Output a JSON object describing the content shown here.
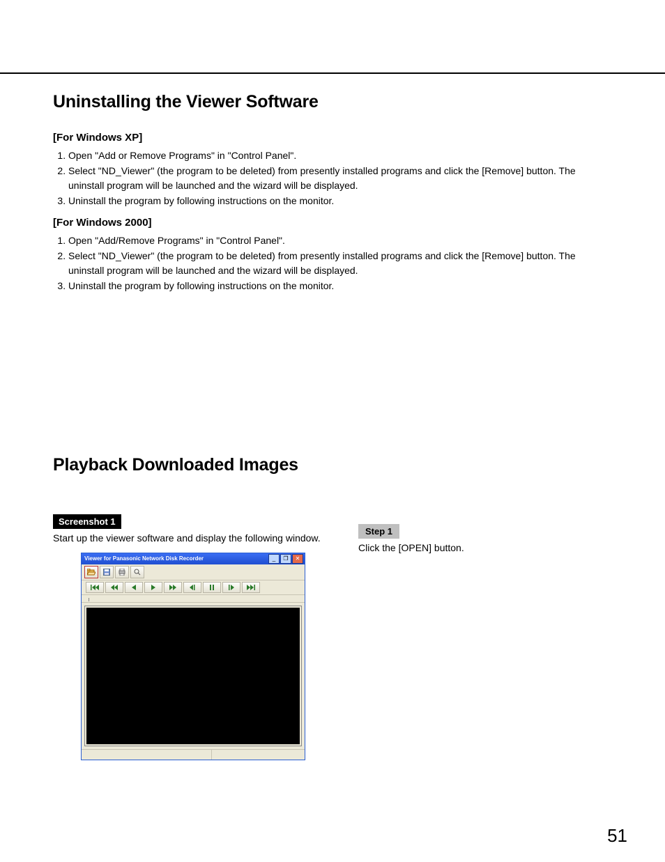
{
  "section1": {
    "title": "Uninstalling the Viewer Software",
    "xp": {
      "heading": "[For Windows XP]",
      "steps": [
        "Open \"Add or Remove Programs\" in \"Control Panel\".",
        "Select \"ND_Viewer\" (the program to be deleted) from presently installed programs and click the [Remove] button. The uninstall program will be launched and the wizard will be displayed.",
        "Uninstall the program by following instructions on the monitor."
      ]
    },
    "w2k": {
      "heading": "[For Windows 2000]",
      "steps": [
        "Open \"Add/Remove Programs\" in \"Control Panel\".",
        "Select \"ND_Viewer\" (the program to be deleted) from presently installed programs and click the [Remove] button. The uninstall program will be launched and the wizard will be displayed.",
        "Uninstall the program by following instructions on the monitor."
      ]
    }
  },
  "section2": {
    "title": "Playback Downloaded Images",
    "screenshot_label": "Screenshot 1",
    "screenshot_caption": "Start up the viewer software and display the following window.",
    "step_label": "Step 1",
    "step_text": "Click the [OPEN] button.",
    "viewer": {
      "window_title": "Viewer for Panasonic Network Disk Recorder",
      "toolbar_icons": [
        "open-icon",
        "save-icon",
        "print-icon",
        "zoom-icon"
      ],
      "playback_icons": [
        "skip-back-icon",
        "rewind-icon",
        "back-icon",
        "play-icon",
        "fast-forward-icon",
        "step-back-icon",
        "pause-icon",
        "step-forward-icon",
        "skip-forward-icon"
      ]
    }
  },
  "page_number": "51"
}
